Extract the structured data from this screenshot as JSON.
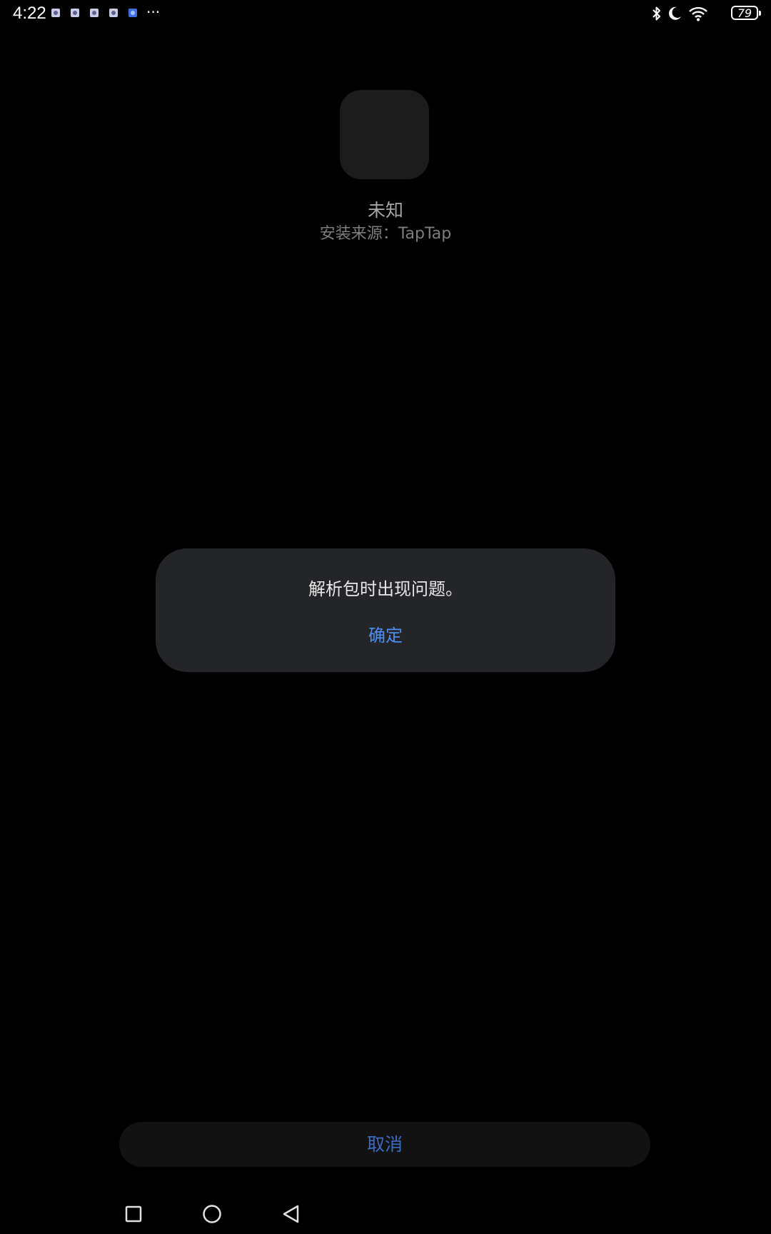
{
  "status_bar": {
    "time": "4:22",
    "more": "···",
    "battery": "79"
  },
  "app": {
    "name": "未知",
    "install_source": "安装来源：TapTap"
  },
  "dialog": {
    "message": "解析包时出现问题。",
    "confirm_label": "确定"
  },
  "footer": {
    "cancel_label": "取消"
  },
  "colors": {
    "accent": "#4d8ef5",
    "dialog_bg": "#242528",
    "background": "#000000"
  }
}
